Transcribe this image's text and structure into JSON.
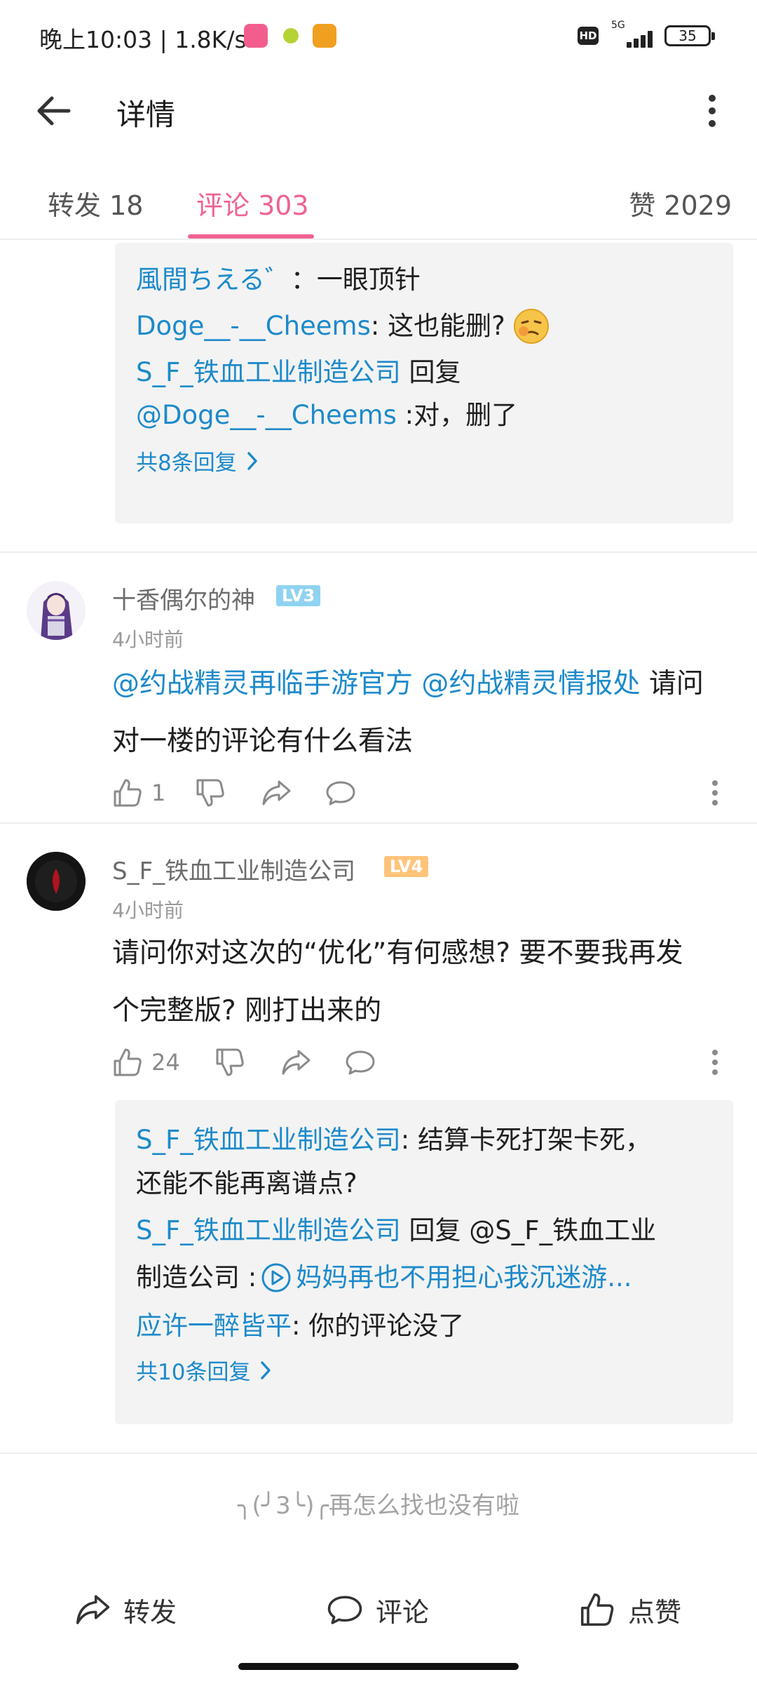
{
  "status_bar": {
    "time": "晚上10:03 | 1.8K/s",
    "network": "5G",
    "battery": "35"
  },
  "header": {
    "title": "详情"
  },
  "tabs": [
    {
      "label": "转发 18"
    },
    {
      "label": "评论 303"
    },
    {
      "label": "赞 2029"
    }
  ],
  "reply_box_1": {
    "line1_user": "風間ちえる゛",
    "line1_text": "：一眼顶针",
    "line2_user": "Doge__-__Cheems",
    "line2_text": ": 这也能删?",
    "line3_user": "S_F_铁血工业制造公司",
    "line3_text": " 回复",
    "line4_user": "@Doge__-__Cheems",
    "line4_text": " :对，删了",
    "more": "共8条回复"
  },
  "comments": [
    {
      "user": "十香偶尔的神",
      "level": "LV3",
      "time": "4小时前",
      "mention1": "@约战精灵再临手游官方",
      "mention2": "@约战精灵情报处",
      "text1": " 请问",
      "text2": "对一楼的评论有什么看法",
      "likes": "1"
    },
    {
      "user": "S_F_铁血工业制造公司",
      "level": "LV4",
      "time": "4小时前",
      "text1": "请问你对这次的“优化”有何感想? 要不要我再发",
      "text2": "个完整版? 刚打出来的",
      "likes": "24"
    }
  ],
  "reply_box_2": {
    "line1_user": "S_F_铁血工业制造公司",
    "line1_text": ": 结算卡死打架卡死，",
    "line2_text": "还能不能再离谱点?",
    "line3_user": "S_F_铁血工业制造公司",
    "line3_text": " 回复 @S_F_铁血工业",
    "line4_text": "制造公司 :",
    "line4_link": "妈妈再也不用担心我沉迷游...",
    "line5_user": "应许一醉皆平",
    "line5_text": ": 你的评论没了",
    "more": "共10条回复"
  },
  "end_text": "╮(╯3╰)╭再怎么找也没有啦",
  "bottom_bar": {
    "forward": "转发",
    "comment": "评论",
    "like": "点赞"
  },
  "colors": {
    "accent_pink": "#ef6293",
    "link_blue": "#1d8acb",
    "lv3": "#8fd3f1",
    "lv4": "#ffc47a"
  }
}
